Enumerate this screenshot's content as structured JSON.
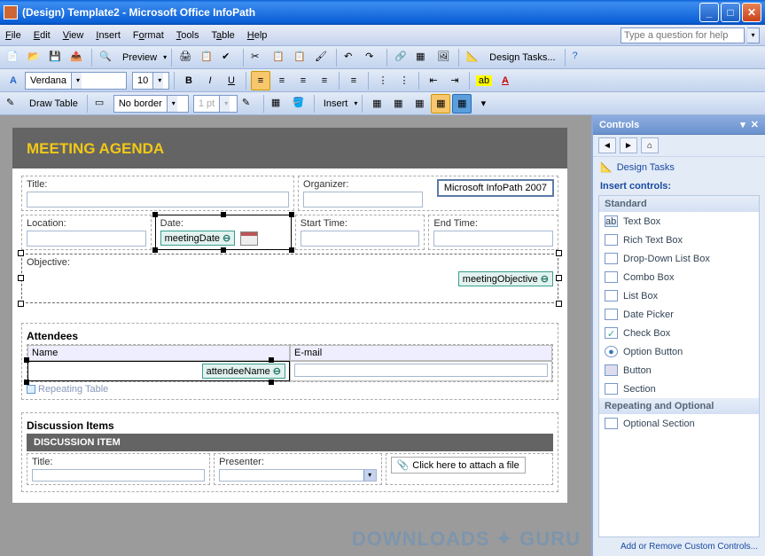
{
  "window": {
    "title": "(Design) Template2 - Microsoft Office InfoPath"
  },
  "menu": {
    "file": "File",
    "edit": "Edit",
    "view": "View",
    "insert": "Insert",
    "format": "Format",
    "tools": "Tools",
    "table": "Table",
    "help": "Help",
    "helpbox_placeholder": "Type a question for help"
  },
  "toolbar": {
    "preview": "Preview",
    "design_tasks": "Design Tasks...",
    "font_name": "Verdana",
    "font_size": "10",
    "draw_table": "Draw Table",
    "no_border": "No border",
    "border_width": "1 pt",
    "insert": "Insert"
  },
  "form": {
    "heading": "MEETING AGENDA",
    "title_label": "Title:",
    "organizer_label": "Organizer:",
    "version_tag": "Microsoft InfoPath 2007",
    "location_label": "Location:",
    "date_label": "Date:",
    "date_binding": "meetingDate",
    "start_label": "Start Time:",
    "end_label": "End Time:",
    "objective_label": "Objective:",
    "objective_binding": "meetingObjective",
    "attendees_heading": "Attendees",
    "attendee_name_col": "Name",
    "attendee_email_col": "E-mail",
    "attendee_binding": "attendeeName",
    "repeating_table": "Repeating Table",
    "discussion_heading": "Discussion Items",
    "discussion_item_hdr": "DISCUSSION ITEM",
    "disc_title_label": "Title:",
    "disc_presenter_label": "Presenter:",
    "attach_text": "Click here to attach a file"
  },
  "taskpane": {
    "title": "Controls",
    "design_tasks_link": "Design Tasks",
    "insert_heading": "Insert controls:",
    "cat_standard": "Standard",
    "cat_repeating": "Repeating and Optional",
    "controls": {
      "textbox": "Text Box",
      "richtext": "Rich Text Box",
      "dropdown": "Drop-Down List Box",
      "combobox": "Combo Box",
      "listbox": "List Box",
      "datepicker": "Date Picker",
      "checkbox": "Check Box",
      "option": "Option Button",
      "button": "Button",
      "section": "Section",
      "optsection": "Optional Section"
    },
    "footer_link": "Add or Remove Custom Controls..."
  },
  "watermark": "DOWNLOADS ✦ GURU"
}
